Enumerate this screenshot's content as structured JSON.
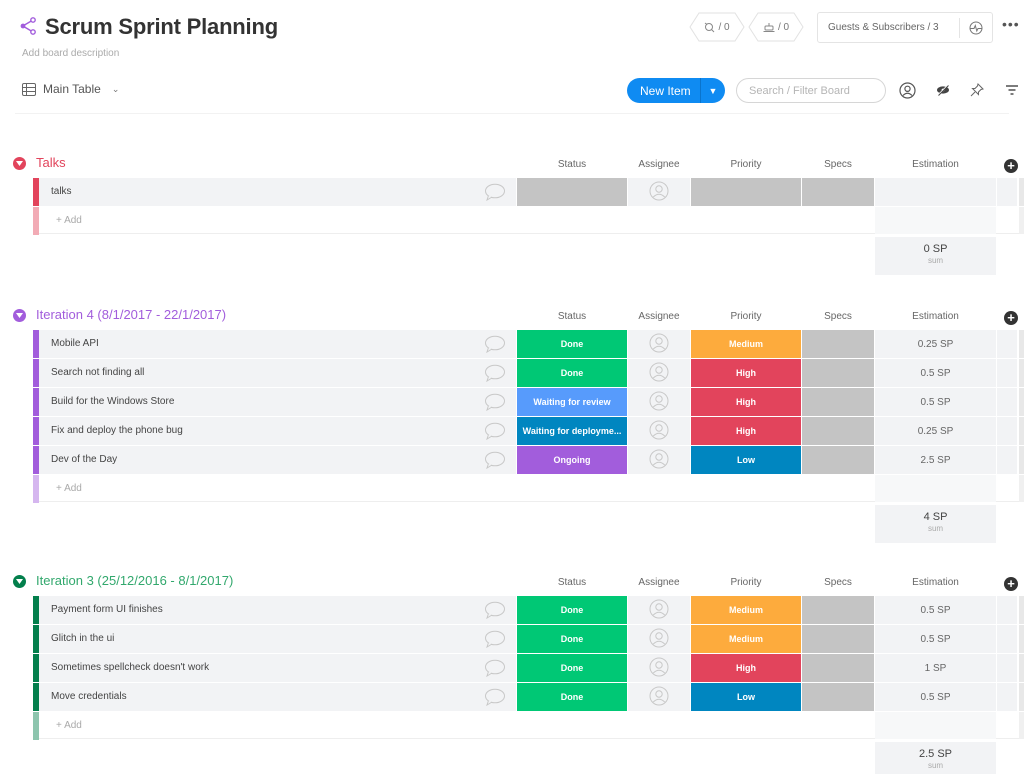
{
  "board": {
    "title": "Scrum Sprint Planning",
    "description": "Add board description",
    "activity_count": "/ 0",
    "integrations_count": "/ 0",
    "guests_label": "Guests & Subscribers / 3",
    "more_label": "•••"
  },
  "toolbar": {
    "view_label": "Main Table",
    "new_item_label": "New Item",
    "search_placeholder": "Search / Filter Board"
  },
  "columns": {
    "status": "Status",
    "assignee": "Assignee",
    "priority": "Priority",
    "specs": "Specs",
    "estimation": "Estimation"
  },
  "colors": {
    "done": "#00c875",
    "waiting_review": "#579bfc",
    "waiting_deploy": "#0086c0",
    "ongoing": "#a25ddc",
    "medium": "#fdab3d",
    "high": "#e2445c",
    "low": "#0086c0",
    "empty": "#c4c4c4",
    "primary": "#0f8bf2"
  },
  "groups": [
    {
      "title": "Talks",
      "color": "#e2445c",
      "add_label": "+ Add",
      "sum_value": "0 SP",
      "sum_label": "sum",
      "items": [
        {
          "name": "talks",
          "status": "",
          "status_color": "#c4c4c4",
          "priority": "",
          "priority_color": "#c4c4c4",
          "estimation": ""
        }
      ]
    },
    {
      "title": "Iteration 4 (8/1/2017 - 22/1/2017)",
      "color": "#a25ddc",
      "add_label": "+ Add",
      "sum_value": "4 SP",
      "sum_label": "sum",
      "items": [
        {
          "name": "Mobile API",
          "status": "Done",
          "status_color": "#00c875",
          "priority": "Medium",
          "priority_color": "#fdab3d",
          "estimation": "0.25 SP"
        },
        {
          "name": "Search not finding all",
          "status": "Done",
          "status_color": "#00c875",
          "priority": "High",
          "priority_color": "#e2445c",
          "estimation": "0.5 SP"
        },
        {
          "name": "Build for the Windows Store",
          "status": "Waiting for review",
          "status_color": "#579bfc",
          "priority": "High",
          "priority_color": "#e2445c",
          "estimation": "0.5 SP"
        },
        {
          "name": "Fix and deploy the phone bug",
          "status": "Waiting for deployme...",
          "status_color": "#0086c0",
          "priority": "High",
          "priority_color": "#e2445c",
          "estimation": "0.25 SP"
        },
        {
          "name": "Dev of the Day",
          "status": "Ongoing",
          "status_color": "#a25ddc",
          "priority": "Low",
          "priority_color": "#0086c0",
          "estimation": "2.5 SP"
        }
      ]
    },
    {
      "title": "Iteration 3 (25/12/2016 - 8/1/2017)",
      "color": "#037f4c",
      "title_color": "#32a86d",
      "add_label": "+ Add",
      "sum_value": "2.5 SP",
      "sum_label": "sum",
      "items": [
        {
          "name": "Payment form UI finishes",
          "status": "Done",
          "status_color": "#00c875",
          "priority": "Medium",
          "priority_color": "#fdab3d",
          "estimation": "0.5 SP"
        },
        {
          "name": "Glitch in the ui",
          "status": "Done",
          "status_color": "#00c875",
          "priority": "Medium",
          "priority_color": "#fdab3d",
          "estimation": "0.5 SP"
        },
        {
          "name": "Sometimes spellcheck doesn't work",
          "status": "Done",
          "status_color": "#00c875",
          "priority": "High",
          "priority_color": "#e2445c",
          "estimation": "1 SP"
        },
        {
          "name": "Move credentials",
          "status": "Done",
          "status_color": "#00c875",
          "priority": "Low",
          "priority_color": "#0086c0",
          "estimation": "0.5 SP"
        }
      ]
    }
  ]
}
